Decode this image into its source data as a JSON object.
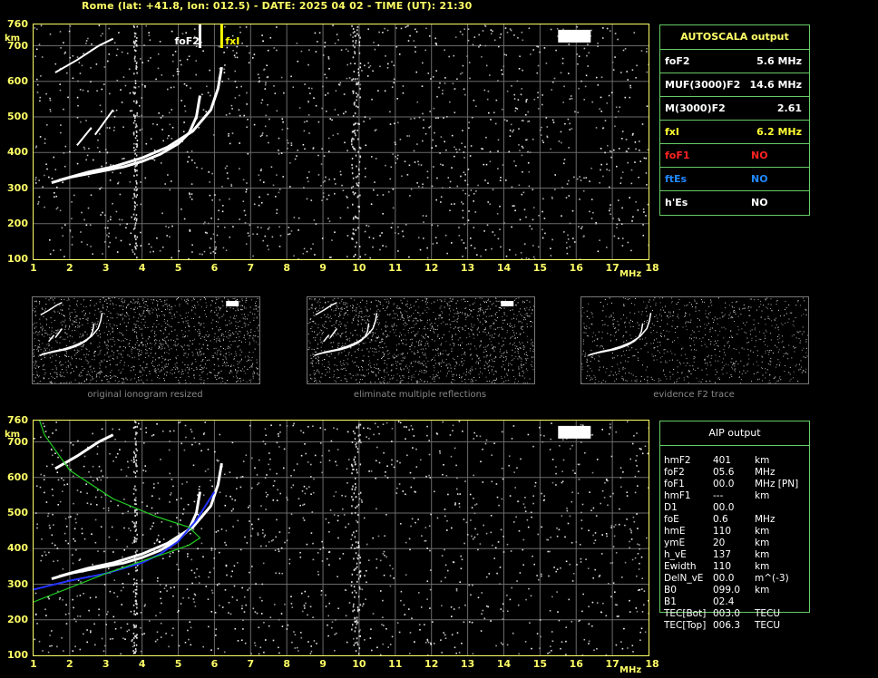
{
  "header": "Rome (lat: +41.8, lon: 012.5) - DATE: 2025 04 02 - TIME (UT): 21:30",
  "colors": {
    "axis": "#ffff66",
    "grid": "#6a6a6a",
    "trace": "#ffffff",
    "fof2_marker": "#ffffff",
    "fxi_marker": "#ffff00",
    "aip_profile": "#22cc22",
    "aip_trace": "#2233ff",
    "panel_border": "#66cc66"
  },
  "axes": {
    "y_ticks": [
      "760",
      "700",
      "600",
      "500",
      "400",
      "300",
      "200",
      "100"
    ],
    "y_unit": "km",
    "x_ticks": [
      "1",
      "2",
      "3",
      "4",
      "5",
      "6",
      "7",
      "8",
      "9",
      "10",
      "11",
      "12",
      "13",
      "14",
      "15",
      "16",
      "17",
      "18"
    ],
    "x_unit": "MHz"
  },
  "chart_data": [
    {
      "type": "scatter",
      "x_unit": "MHz",
      "y_unit": "km",
      "xlim": [
        1,
        18
      ],
      "ylim": [
        100,
        760
      ],
      "grid": true,
      "markers": [
        {
          "label": "foF2",
          "x": 5.6
        },
        {
          "label": "fxI",
          "x": 6.2
        }
      ],
      "traces": [
        {
          "points": [
            [
              1.5,
              315
            ],
            [
              2.0,
              330
            ],
            [
              2.5,
              340
            ],
            [
              3.0,
              350
            ],
            [
              3.5,
              360
            ],
            [
              4.0,
              375
            ],
            [
              4.5,
              395
            ],
            [
              5.0,
              425
            ],
            [
              5.3,
              455
            ],
            [
              5.5,
              500
            ],
            [
              5.6,
              560
            ]
          ]
        },
        {
          "points": [
            [
              1.7,
              322
            ],
            [
              2.5,
              345
            ],
            [
              3.2,
              360
            ],
            [
              4.0,
              385
            ],
            [
              4.7,
              415
            ],
            [
              5.4,
              460
            ],
            [
              5.9,
              520
            ],
            [
              6.1,
              580
            ],
            [
              6.2,
              640
            ]
          ]
        },
        {
          "points": [
            [
              1.6,
              625
            ],
            [
              2.2,
              660
            ],
            [
              2.8,
              700
            ],
            [
              3.2,
              720
            ]
          ]
        },
        {
          "points": [
            [
              2.7,
              450
            ],
            [
              3.2,
              520
            ]
          ]
        },
        {
          "points": [
            [
              2.2,
              420
            ],
            [
              2.6,
              470
            ]
          ]
        }
      ]
    },
    {
      "type": "line",
      "x_unit": "MHz",
      "y_unit": "km",
      "xlim": [
        1,
        18
      ],
      "ylim": [
        100,
        760
      ],
      "grid": true,
      "series": [
        {
          "points": [
            [
              1.0,
              285
            ],
            [
              2.0,
              310
            ],
            [
              3.0,
              330
            ],
            [
              4.0,
              360
            ],
            [
              4.5,
              385
            ],
            [
              5.0,
              420
            ],
            [
              5.5,
              480
            ],
            [
              6.0,
              560
            ]
          ]
        },
        {
          "points": [
            [
              1.0,
              250
            ],
            [
              2.0,
              290
            ],
            [
              3.0,
              330
            ],
            [
              4.0,
              365
            ],
            [
              4.6,
              385
            ],
            [
              5.3,
              410
            ],
            [
              5.6,
              430
            ],
            [
              5.3,
              460
            ],
            [
              4.4,
              490
            ],
            [
              3.2,
              540
            ],
            [
              2.0,
              620
            ],
            [
              1.3,
              720
            ],
            [
              1.1,
              780
            ]
          ]
        }
      ]
    }
  ],
  "autoscala": {
    "title": "AUTOSCALA output",
    "rows": [
      {
        "param": "foF2",
        "value": "5.6 MHz",
        "color": "#ffffff"
      },
      {
        "param": "MUF(3000)F2",
        "value": "14.6 MHz",
        "color": "#ffffff"
      },
      {
        "param": "M(3000)F2",
        "value": "2.61",
        "color": "#ffffff"
      },
      {
        "param": "fxI",
        "value": "6.2 MHz",
        "color": "#ffff33"
      },
      {
        "param": "foF1",
        "value": "NO",
        "color": "#ff2222"
      },
      {
        "param": "ftEs",
        "value": "NO",
        "color": "#2288ff"
      },
      {
        "param": "h'Es",
        "value": "NO",
        "color": "#ffffff"
      }
    ]
  },
  "thumbnails": [
    {
      "caption": "original ionogram resized"
    },
    {
      "caption": "eliminate multiple reflections"
    },
    {
      "caption": "evidence F2 trace"
    }
  ],
  "aip": {
    "title": "AIP output",
    "rows": [
      {
        "param": "hmF2",
        "value": "401",
        "unit": "km"
      },
      {
        "param": "foF2",
        "value": "05.6",
        "unit": "MHz"
      },
      {
        "param": "foF1",
        "value": "00.0",
        "unit": "MHz   [PN]"
      },
      {
        "param": "hmF1",
        "value": "---",
        "unit": "km"
      },
      {
        "param": "D1",
        "value": "00.0",
        "unit": ""
      },
      {
        "param": "foE",
        "value": "0.6",
        "unit": "MHz"
      },
      {
        "param": "hmE",
        "value": "110",
        "unit": "km"
      },
      {
        "param": "ymE",
        "value": "20",
        "unit": "km"
      },
      {
        "param": "h_vE",
        "value": "137",
        "unit": "km"
      },
      {
        "param": "Ewidth",
        "value": "110",
        "unit": "km"
      },
      {
        "param": "DelN_vE",
        "value": "00.0",
        "unit": "m^(-3)"
      },
      {
        "param": "B0",
        "value": "099.0",
        "unit": "km"
      },
      {
        "param": "B1",
        "value": "02.4",
        "unit": ""
      },
      {
        "param": "TEC[Bot]",
        "value": "003.0",
        "unit": "TECU"
      },
      {
        "param": "TEC[Top]",
        "value": "006.3",
        "unit": "TECU"
      }
    ]
  }
}
